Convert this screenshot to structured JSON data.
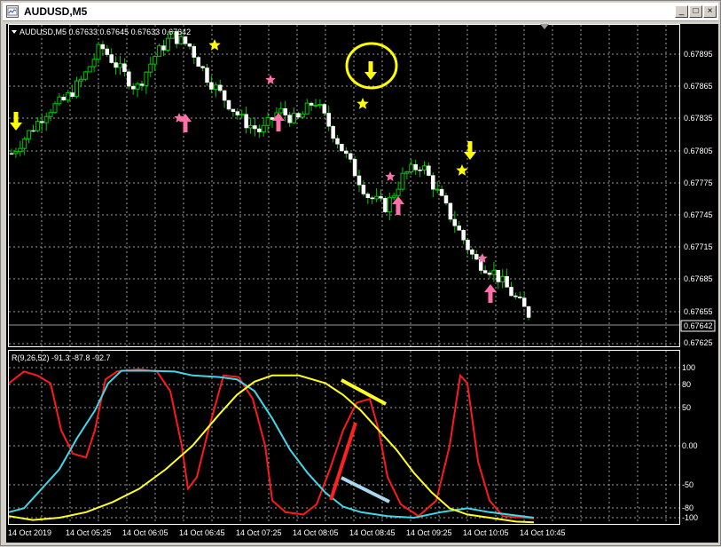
{
  "window": {
    "title": "AUDUSD,M5",
    "buttons": {
      "minimize": "_",
      "maximize": "□",
      "close": "×"
    }
  },
  "chart": {
    "info_label": "AUDUSD,M5  0.67633 0.67645 0.67633 0.67642",
    "price_axis_labels": [
      "0.67895",
      "0.67865",
      "0.67835",
      "0.67805",
      "0.67775",
      "0.67745",
      "0.67715",
      "0.67685",
      "0.67655",
      "0.67625"
    ],
    "current_price": "0.67642",
    "indicator_label": "R(9,26,52) -91.3 -87.8 -92.7",
    "indicator_axis_labels": [
      "100",
      "80",
      "50",
      "0.00",
      "-50",
      "-80",
      "-100"
    ],
    "time_labels": [
      "14 Oct 2019",
      "14 Oct 05:25",
      "14 Oct 06:05",
      "14 Oct 06:45",
      "14 Oct 07:25",
      "14 Oct 08:05",
      "14 Oct 08:45",
      "14 Oct 09:25",
      "14 Oct 10:05",
      "14 Oct 10:45"
    ],
    "colors": {
      "background": "#000000",
      "grid": "#9a9a9a",
      "bull_candle": "#ffffff",
      "wick": "#00c800",
      "fast_line": "#ff1a1a",
      "mid_line": "#40d8e8",
      "slow_line": "#ffff20",
      "star_yellow": "#ffff00",
      "star_pink": "#ff6fa8",
      "arrow_yellow": "#ffff00",
      "arrow_pink": "#ff6fa8"
    }
  },
  "chart_data": [
    {
      "type": "candlestick",
      "title": "AUDUSD,M5",
      "ylim": [
        0.6761,
        0.6791
      ],
      "x": [
        "14 Oct 2019",
        "14 Oct 05:25",
        "14 Oct 06:05",
        "14 Oct 06:45",
        "14 Oct 07:25",
        "14 Oct 08:05",
        "14 Oct 08:45",
        "14 Oct 09:25",
        "14 Oct 10:05",
        "14 Oct 10:45"
      ],
      "close_path": [
        0.6779,
        0.6781,
        0.6783,
        0.6784,
        0.6786,
        0.6789,
        0.6787,
        0.6785,
        0.6788,
        0.679,
        0.6789,
        0.6786,
        0.6784,
        0.6782,
        0.6781,
        0.6783,
        0.6782,
        0.6784,
        0.6781,
        0.6778,
        0.6775,
        0.6774,
        0.6777,
        0.6778,
        0.6775,
        0.6772,
        0.6769,
        0.6768,
        0.6766,
        0.6764
      ],
      "last": 0.67642,
      "grid": true
    },
    {
      "type": "line",
      "title": "R(9,26,52)",
      "ylim": [
        -100,
        100
      ],
      "series": [
        {
          "name": "9",
          "last": -91.3
        },
        {
          "name": "26",
          "last": -87.8
        },
        {
          "name": "52",
          "last": -92.7
        }
      ],
      "grid": true
    }
  ]
}
